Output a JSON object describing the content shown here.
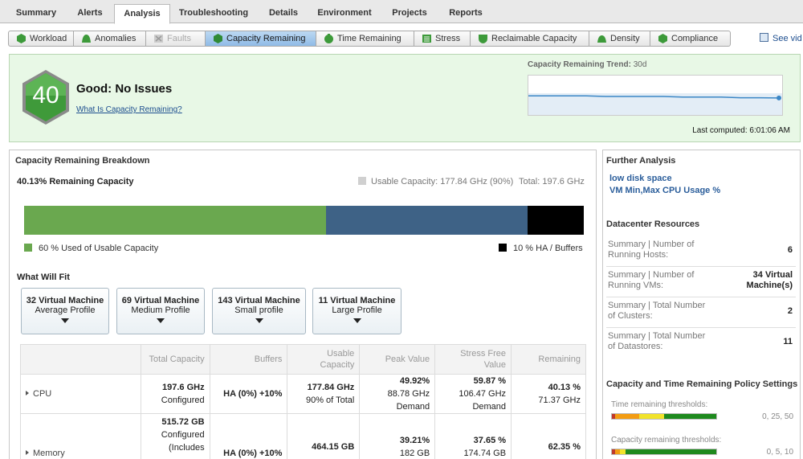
{
  "top_tabs": [
    {
      "label": "Summary"
    },
    {
      "label": "Alerts"
    },
    {
      "label": "Analysis"
    },
    {
      "label": "Troubleshooting"
    },
    {
      "label": "Details"
    },
    {
      "label": "Environment"
    },
    {
      "label": "Projects"
    },
    {
      "label": "Reports"
    }
  ],
  "active_top_tab": "Analysis",
  "sub_tabs": [
    {
      "label": "Workload",
      "icon": "workload-icon"
    },
    {
      "label": "Anomalies",
      "icon": "anomalies-icon"
    },
    {
      "label": "Faults",
      "icon": "faults-icon"
    },
    {
      "label": "Capacity Remaining",
      "icon": "capacity-remaining-icon"
    },
    {
      "label": "Time Remaining",
      "icon": "time-remaining-icon"
    },
    {
      "label": "Stress",
      "icon": "stress-icon"
    },
    {
      "label": "Reclaimable Capacity",
      "icon": "reclaimable-capacity-icon"
    },
    {
      "label": "Density",
      "icon": "density-icon"
    },
    {
      "label": "Compliance",
      "icon": "compliance-icon"
    }
  ],
  "active_sub_tab": "Capacity Remaining",
  "see_video_label": "See vid",
  "status": {
    "score": "40",
    "title": "Good: No Issues",
    "link": "What Is Capacity Remaining?",
    "badge_color": "#3f9a3a"
  },
  "trend": {
    "title": "Capacity Remaining Trend:",
    "period": "30d",
    "values": [
      40.3,
      40.3,
      40.3,
      40.3,
      40.25,
      40.25,
      40.25,
      40.25,
      40.2,
      40.2,
      40.2,
      40.15,
      40.15,
      40.13
    ],
    "line_color": "#3b87c6"
  },
  "last_computed": "Last computed: 6:01:06 AM",
  "breakdown": {
    "title": "Capacity Remaining Breakdown",
    "remaining_label": "40.13% Remaining Capacity",
    "usable_label": "Usable Capacity: 177.84 GHz (90%)",
    "total_label": "Total: 197.6 GHz",
    "segments": [
      {
        "name": "used",
        "percent": 54,
        "color": "#6aa84f"
      },
      {
        "name": "remaining",
        "percent": 36,
        "color": "#3e6286"
      },
      {
        "name": "ha-buffers",
        "percent": 10,
        "color": "#000000"
      }
    ],
    "legend_used": "60 % Used of Usable Capacity",
    "legend_ha": "10 % HA / Buffers"
  },
  "what_will_fit": {
    "title": "What Will Fit",
    "cards": [
      {
        "count": "32 Virtual Machine",
        "profile": "Average Profile"
      },
      {
        "count": "69 Virtual Machine",
        "profile": "Medium Profile"
      },
      {
        "count": "143 Virtual Machine",
        "profile": "Small profile"
      },
      {
        "count": "11 Virtual Machine",
        "profile": "Large Profile"
      }
    ]
  },
  "table": {
    "headers": [
      "",
      "Total Capacity",
      "Buffers",
      "Usable Capacity",
      "Peak Value",
      "Stress Free\nValue",
      "Remaining"
    ],
    "rows": [
      {
        "name": "CPU",
        "total": [
          "197.6 GHz",
          "Configured"
        ],
        "buffers": "HA (0%) +10%",
        "usable": [
          "177.84 GHz",
          "90% of Total"
        ],
        "peak": [
          "49.92%",
          "88.78 GHz",
          "Demand"
        ],
        "stress_free": [
          "59.87 %",
          "106.47 GHz",
          "Demand"
        ],
        "remaining": [
          "40.13 %",
          "71.37 GHz"
        ]
      },
      {
        "name": "Memory",
        "total": [
          "515.72 GB",
          "Configured",
          "(Includes"
        ],
        "buffers": "HA (0%) +10%",
        "usable": [
          "464.15 GB"
        ],
        "peak": [
          "39.21%",
          "182 GB"
        ],
        "stress_free": [
          "37.65 %",
          "174.74 GB"
        ],
        "remaining": [
          "62.35 %"
        ]
      }
    ]
  },
  "further_analysis": {
    "title": "Further Analysis",
    "links": [
      "low disk space",
      "VM Min,Max CPU Usage %"
    ]
  },
  "datacenter": {
    "title": "Datacenter Resources",
    "rows": [
      {
        "label": "Summary | Number of Running Hosts:",
        "value": "6"
      },
      {
        "label": "Summary | Number of Running VMs:",
        "value": "34 Virtual Machine(s)"
      },
      {
        "label": "Summary | Total Number of Clusters:",
        "value": "2"
      },
      {
        "label": "Summary | Total Number of Datastores:",
        "value": "11"
      }
    ]
  },
  "policy": {
    "title": "Capacity and Time Remaining Policy Settings",
    "time_label": "Time remaining thresholds:",
    "time_values": "0, 25, 50",
    "capacity_label": "Capacity remaining thresholds:",
    "capacity_values": "0, 5, 10"
  }
}
